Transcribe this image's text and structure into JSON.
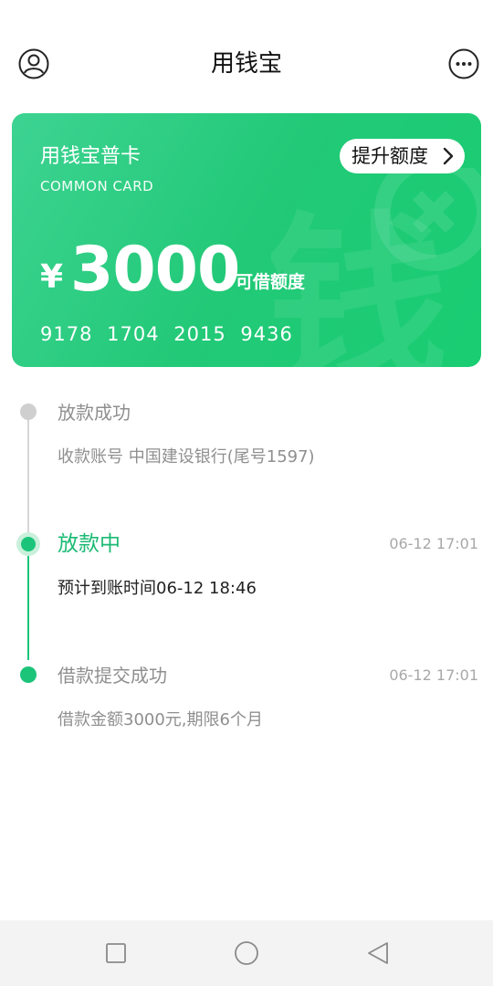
{
  "header": {
    "title": "用钱宝",
    "profile_icon": "user-circle-icon",
    "more_icon": "more-dots-icon"
  },
  "card": {
    "name": "用钱宝普卡",
    "subtitle": "COMMON CARD",
    "raise_button_label": "提升额度",
    "currency_symbol": "¥",
    "amount": "3000",
    "amount_label": "可借额度",
    "number_groups": [
      "9178",
      "1704",
      "2015",
      "9436"
    ],
    "watermark_glyph": "钱"
  },
  "timeline": {
    "steps": [
      {
        "title": "放款成功",
        "detail": "收款账号 中国建设银行(尾号1597)",
        "time": "",
        "status": "pending"
      },
      {
        "title": "放款中",
        "detail": "预计到账时间06-12 18:46",
        "time": "06-12 17:01",
        "status": "current"
      },
      {
        "title": "借款提交成功",
        "detail": "借款金额3000元,期限6个月",
        "time": "06-12 17:01",
        "status": "done"
      }
    ]
  },
  "navbar": {
    "items": [
      "recents-square-icon",
      "home-circle-icon",
      "back-triangle-icon"
    ]
  },
  "colors": {
    "accent_green": "#1cc47a",
    "card_gradient_start": "#3dd392",
    "card_gradient_end": "#19cd72",
    "muted_gray": "#8f8f8f"
  }
}
